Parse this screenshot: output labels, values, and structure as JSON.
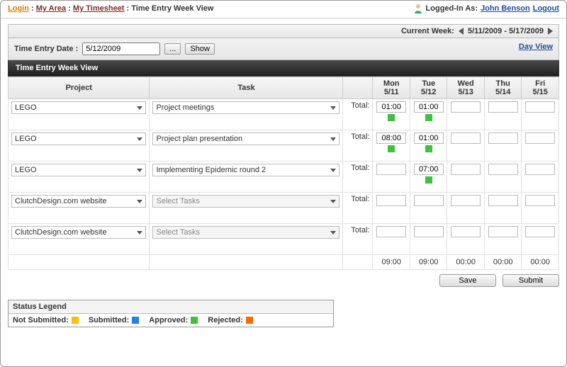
{
  "breadcrumb": {
    "login": "Login",
    "area": "My Area",
    "timesheet": "My Timesheet",
    "current": "Time Entry Week View"
  },
  "user": {
    "label": "Logged-In As:",
    "name": "John Benson",
    "logout": "Logout"
  },
  "weekbar": {
    "label": "Current Week:",
    "range": "5/11/2009 - 5/17/2009"
  },
  "datebar": {
    "label": "Time Entry Date :",
    "value": "5/12/2009",
    "browse": "...",
    "show": "Show",
    "dayview": "Day View"
  },
  "section_title": "Time Entry Week View",
  "columns": {
    "project": "Project",
    "task": "Task",
    "total": "Total:",
    "days": [
      {
        "dow": "Mon",
        "date": "5/11"
      },
      {
        "dow": "Tue",
        "date": "5/12"
      },
      {
        "dow": "Wed",
        "date": "5/13"
      },
      {
        "dow": "Thu",
        "date": "5/14"
      },
      {
        "dow": "Fri",
        "date": "5/15"
      }
    ]
  },
  "rows": [
    {
      "project": "LEGO",
      "task": "Project meetings",
      "task_disabled": false,
      "cells": [
        {
          "v": "01:00",
          "st": "green"
        },
        {
          "v": "01:00",
          "st": "green"
        },
        {
          "v": "",
          "st": ""
        },
        {
          "v": "",
          "st": ""
        },
        {
          "v": "",
          "st": ""
        }
      ]
    },
    {
      "project": "LEGO",
      "task": "Project plan presentation",
      "task_disabled": false,
      "cells": [
        {
          "v": "08:00",
          "st": "green"
        },
        {
          "v": "01:00",
          "st": "green"
        },
        {
          "v": "",
          "st": ""
        },
        {
          "v": "",
          "st": ""
        },
        {
          "v": "",
          "st": ""
        }
      ]
    },
    {
      "project": "LEGO",
      "task": "Implementing Epidemic round 2",
      "task_disabled": false,
      "cells": [
        {
          "v": "",
          "st": ""
        },
        {
          "v": "07:00",
          "st": "green"
        },
        {
          "v": "",
          "st": ""
        },
        {
          "v": "",
          "st": ""
        },
        {
          "v": "",
          "st": ""
        }
      ]
    },
    {
      "project": "ClutchDesign.com website",
      "task": "Select Tasks",
      "task_disabled": true,
      "cells": [
        {
          "v": "",
          "st": ""
        },
        {
          "v": "",
          "st": ""
        },
        {
          "v": "",
          "st": ""
        },
        {
          "v": "",
          "st": ""
        },
        {
          "v": "",
          "st": ""
        }
      ]
    },
    {
      "project": "ClutchDesign.com website",
      "task": "Select Tasks",
      "task_disabled": true,
      "cells": [
        {
          "v": "",
          "st": ""
        },
        {
          "v": "",
          "st": ""
        },
        {
          "v": "",
          "st": ""
        },
        {
          "v": "",
          "st": ""
        },
        {
          "v": "",
          "st": ""
        }
      ]
    }
  ],
  "day_totals": [
    "09:00",
    "09:00",
    "00:00",
    "00:00",
    "00:00"
  ],
  "buttons": {
    "save": "Save",
    "submit": "Submit"
  },
  "legend": {
    "title": "Status Legend",
    "not_submitted": "Not Submitted:",
    "submitted": "Submitted:",
    "approved": "Approved:",
    "rejected": "Rejected:"
  }
}
